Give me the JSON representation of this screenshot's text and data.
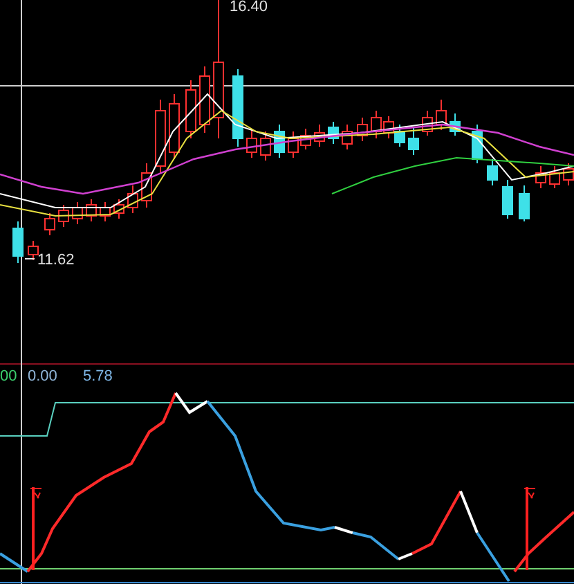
{
  "price_chart": {
    "high_label": "16.40",
    "low_label": "11.62"
  },
  "indicator": {
    "values": [
      {
        "text": "00",
        "color": "#3ccf6e"
      },
      {
        "text": "0.00",
        "color": "#8fb4d6"
      },
      {
        "text": "5.78",
        "color": "#7fb8e8"
      }
    ]
  }
}
